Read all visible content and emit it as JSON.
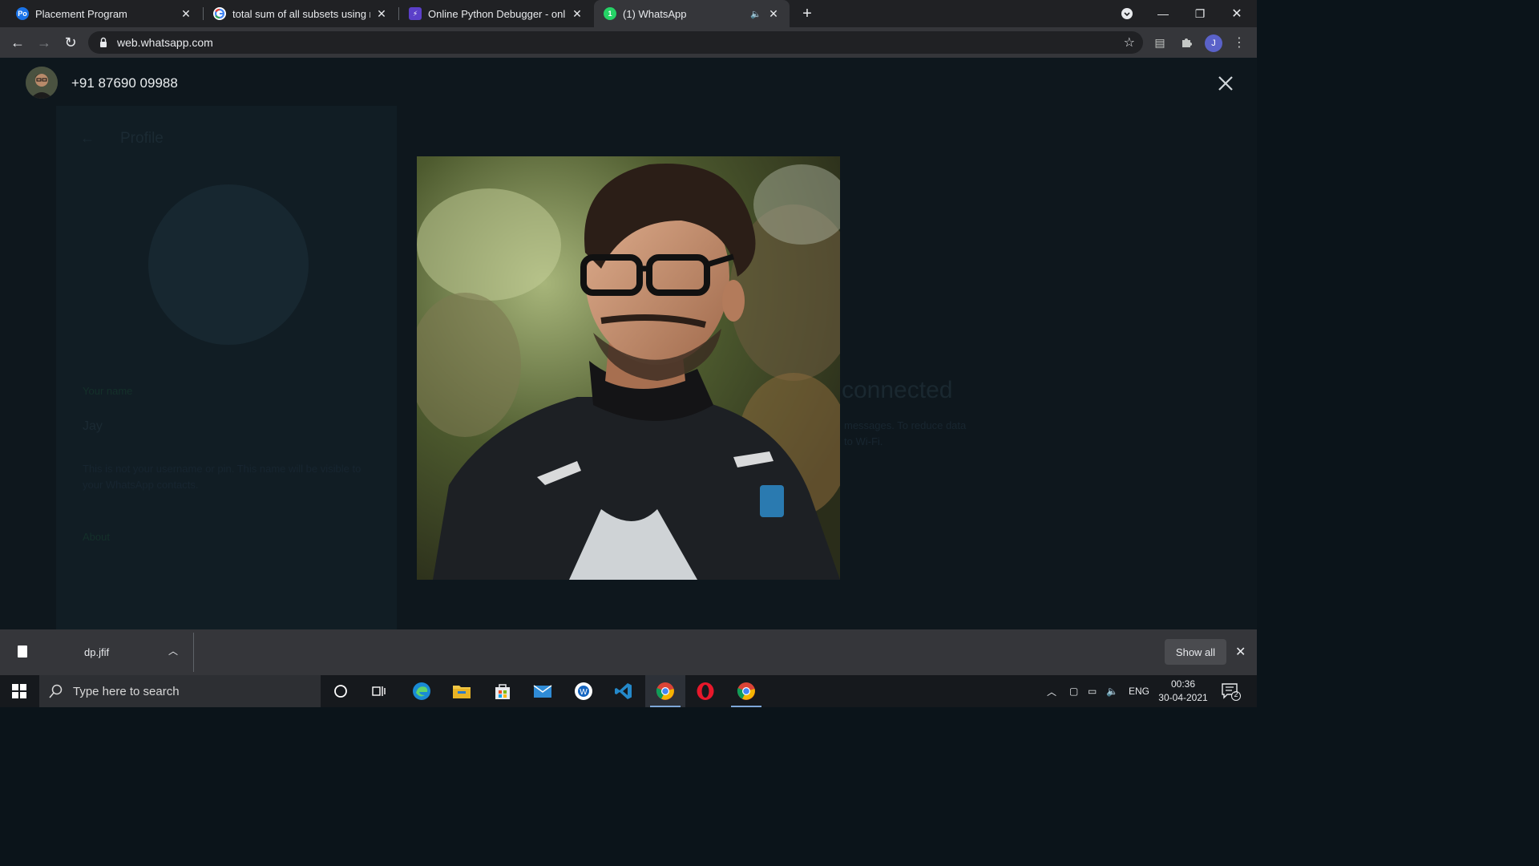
{
  "browser": {
    "tabs": [
      {
        "title": "Placement Program",
        "favicon": "placement-favicon",
        "active": false
      },
      {
        "title": "total sum of all subsets using rec",
        "favicon": "google-favicon",
        "active": false
      },
      {
        "title": "Online Python Debugger - online",
        "favicon": "debugger-favicon",
        "active": false
      },
      {
        "title": "(1) WhatsApp",
        "favicon": "whatsapp-favicon",
        "active": true,
        "audio": true
      }
    ],
    "url": "web.whatsapp.com",
    "profile_initial": "J"
  },
  "viewer": {
    "contact_name": "+91 87690 09988"
  },
  "background_panel": {
    "title": "Profile",
    "name_label": "Your name",
    "name_value": "Jay",
    "name_note": "This is not your username or pin. This name will be visible to your WhatsApp contacts.",
    "about_label": "About",
    "connected_text": "connected",
    "connected_sub1": "messages. To reduce data",
    "connected_sub2": "to Wi-Fi."
  },
  "downloads": {
    "file_name": "dp.jfif",
    "show_all_label": "Show all"
  },
  "taskbar": {
    "search_placeholder": "Type here to search",
    "language": "ENG",
    "time": "00:36",
    "date": "30-04-2021",
    "notification_count": "2"
  },
  "colors": {
    "chrome_dark": "#202124",
    "toolbar": "#35363a",
    "viewer_bg": "#0e171d",
    "whatsapp_green": "#25d366"
  }
}
